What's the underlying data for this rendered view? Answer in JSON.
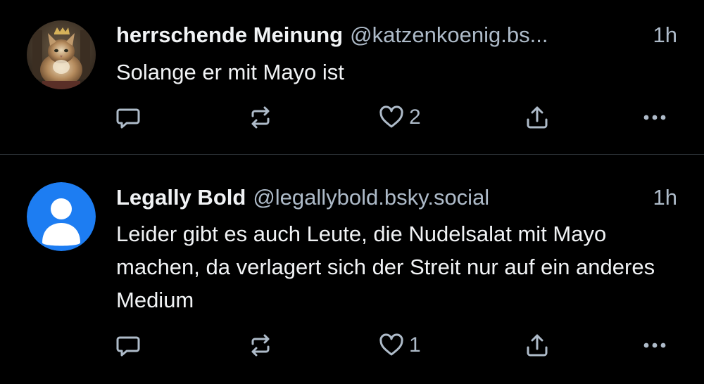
{
  "colors": {
    "background": "#000000",
    "text_primary": "#f1f3f5",
    "text_secondary": "#aebbc9",
    "divider": "#2e3439",
    "default_avatar_bg": "#1d7df2"
  },
  "posts": [
    {
      "author": {
        "display_name": "herrschende Meinung",
        "handle": "@katzenkoenig.bs...",
        "avatar_icon": "cat-photo-avatar"
      },
      "timestamp": "1h",
      "text": "Solange er mit Mayo ist",
      "actions": {
        "reply_icon": "reply-icon",
        "repost_icon": "repost-icon",
        "like_icon": "heart-icon",
        "like_count": "2",
        "share_icon": "share-icon",
        "more_icon": "more-options-icon"
      }
    },
    {
      "author": {
        "display_name": "Legally Bold",
        "handle": "@legallybold.bsky.social",
        "avatar_icon": "default-user-avatar"
      },
      "timestamp": "1h",
      "text": "Leider gibt es auch Leute, die Nudelsalat mit Mayo machen, da verlagert sich der Streit nur auf ein anderes Medium",
      "actions": {
        "reply_icon": "reply-icon",
        "repost_icon": "repost-icon",
        "like_icon": "heart-icon",
        "like_count": "1",
        "share_icon": "share-icon",
        "more_icon": "more-options-icon"
      }
    }
  ]
}
